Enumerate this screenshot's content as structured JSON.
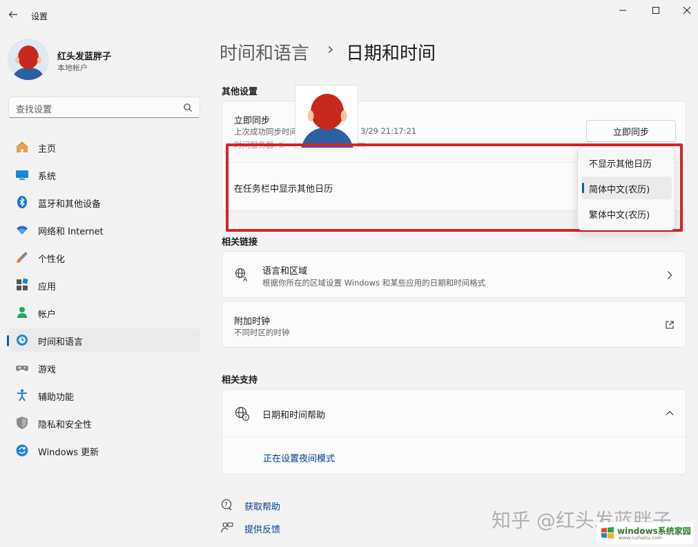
{
  "window": {
    "title": "设置",
    "back_icon": "arrow-left-icon",
    "controls": [
      "minimize-icon",
      "maximize-icon",
      "close-icon"
    ]
  },
  "profile": {
    "name": "红头发蓝胖子",
    "account_type": "本地帐户"
  },
  "search": {
    "placeholder": "查找设置"
  },
  "sidebar": {
    "items": [
      {
        "label": "主页",
        "icon": "home-icon"
      },
      {
        "label": "系统",
        "icon": "monitor-icon"
      },
      {
        "label": "蓝牙和其他设备",
        "icon": "bluetooth-icon"
      },
      {
        "label": "网络和 Internet",
        "icon": "wifi-icon"
      },
      {
        "label": "个性化",
        "icon": "brush-icon"
      },
      {
        "label": "应用",
        "icon": "apps-icon"
      },
      {
        "label": "帐户",
        "icon": "person-icon"
      },
      {
        "label": "时间和语言",
        "icon": "globe-clock-icon",
        "active": true
      },
      {
        "label": "游戏",
        "icon": "gamepad-icon"
      },
      {
        "label": "辅助功能",
        "icon": "accessibility-icon"
      },
      {
        "label": "隐私和安全性",
        "icon": "shield-icon"
      },
      {
        "label": "Windows 更新",
        "icon": "update-icon"
      }
    ]
  },
  "breadcrumb": {
    "parent": "时间和语言",
    "separator": "›",
    "current": "日期和时间"
  },
  "other_settings": {
    "title": "其他设置",
    "sync": {
      "title": "立即同步",
      "last_sync_prefix": "上次成功同步时间",
      "last_sync_suffix": "3/29 21:17:21",
      "server_prefix": "时间服务器: ti",
      "server_suffix": "m",
      "button": "立即同步"
    },
    "calendar": {
      "title": "在任务栏中显示其他日历",
      "options": [
        "不显示其他日历",
        "简体中文(农历)",
        "繁体中文(农历)"
      ],
      "selected_index": 1
    }
  },
  "related_links": {
    "title": "相关链接",
    "language_region": {
      "title": "语言和区域",
      "subtitle": "根据你所在的区域设置 Windows 和某些应用的日期和时间格式"
    },
    "additional_clocks": {
      "title": "附加时钟",
      "subtitle": "不同时区的时钟"
    }
  },
  "related_support": {
    "title": "相关支持",
    "help": {
      "title": "日期和时间帮助",
      "link": "正在设置夜间模式"
    }
  },
  "footer": {
    "get_help": "获取帮助",
    "feedback": "提供反馈"
  },
  "watermark": {
    "text": "知乎 @红头发蓝胖子",
    "logo_text": "windows系统家园",
    "logo_sub": "www.ruihaitu.com"
  },
  "colors": {
    "accent": "#005fb8",
    "highlight_border": "#d9212c",
    "background": "#f3f3f3"
  }
}
